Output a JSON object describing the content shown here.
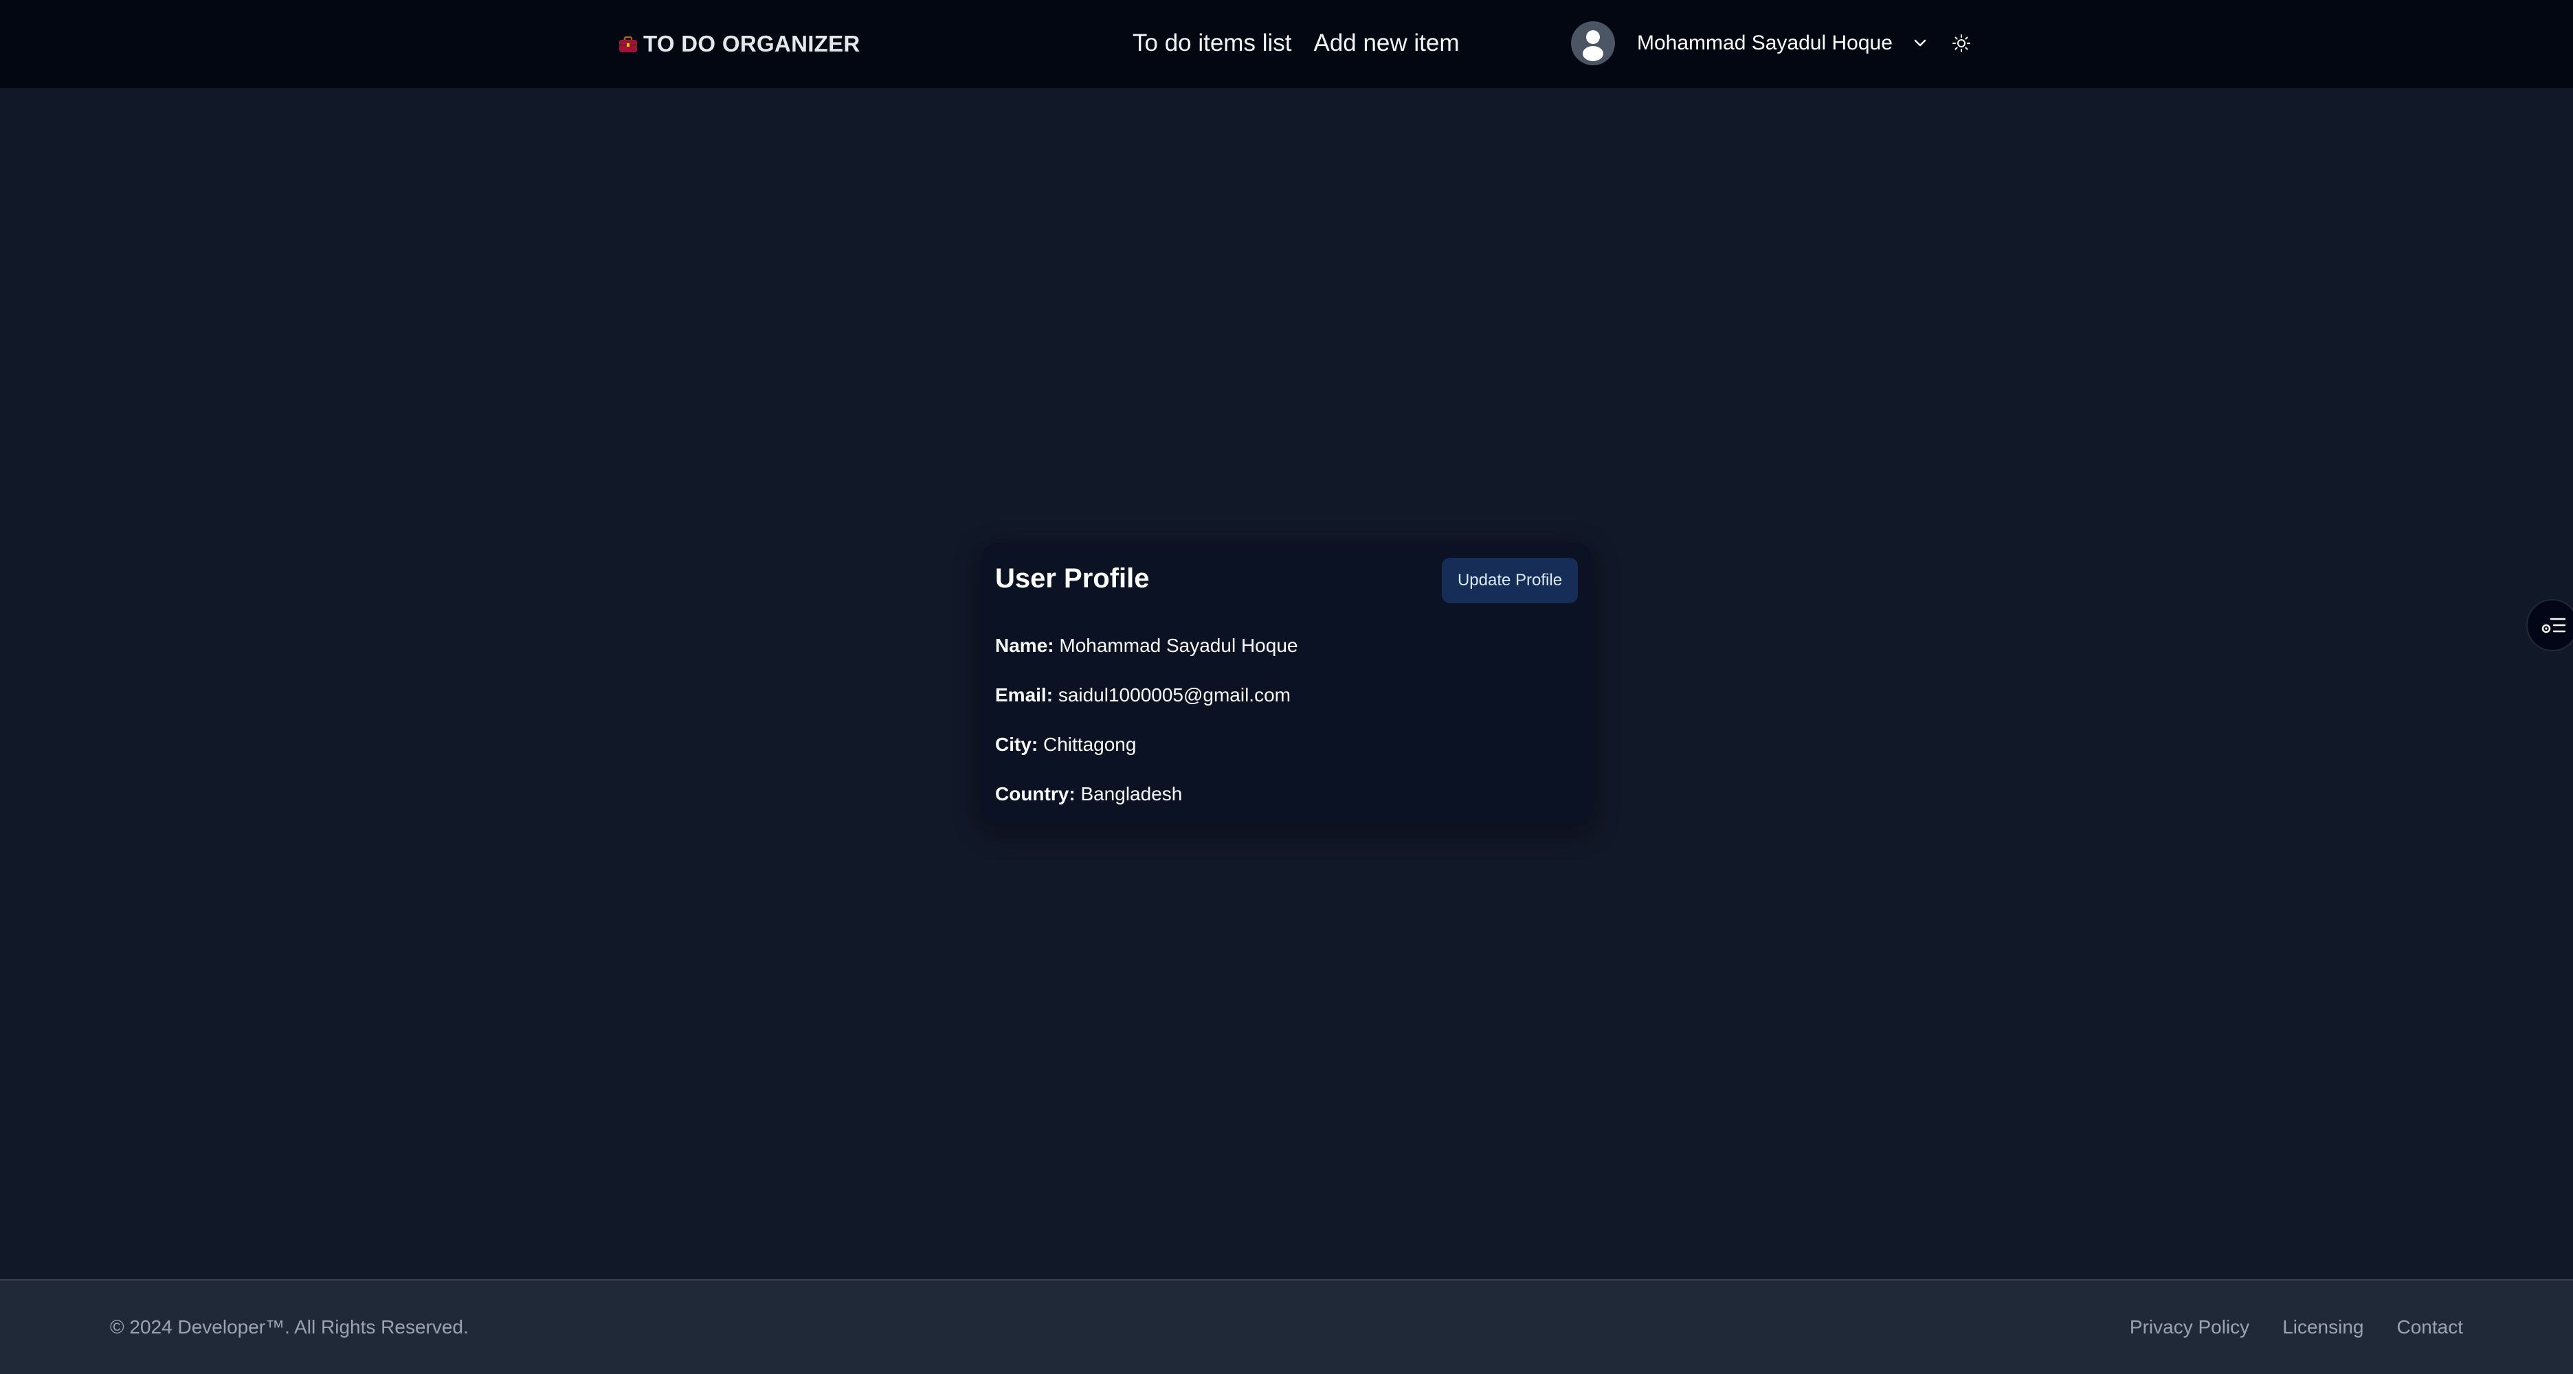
{
  "header": {
    "brand": "TO DO ORGANIZER",
    "brand_icon": "briefcase-icon",
    "nav": [
      "To do items list",
      "Add new item"
    ],
    "user_name": "Mohammad Sayadul Hoque",
    "avatar_icon": "user-avatar-icon",
    "dropdown_icon": "chevron-down-icon",
    "theme_icon": "sun-icon"
  },
  "profile": {
    "title": "User Profile",
    "update_label": "Update Profile",
    "fields": [
      {
        "label": "Name:",
        "value": "Mohammad Sayadul Hoque"
      },
      {
        "label": "Email:",
        "value": "saidul1000005@gmail.com"
      },
      {
        "label": "City:",
        "value": "Chittagong"
      },
      {
        "label": "Country:",
        "value": "Bangladesh"
      }
    ]
  },
  "side_button_icon": "settings-list-icon",
  "footer": {
    "copyright": "© 2024 Developer™. All Rights Reserved.",
    "links": [
      "Privacy Policy",
      "Licensing",
      "Contact"
    ]
  },
  "colors": {
    "background": "#111827",
    "navbar": "#030712",
    "card": "#0b1224",
    "button": "#162d57",
    "footer": "#1f2937"
  }
}
